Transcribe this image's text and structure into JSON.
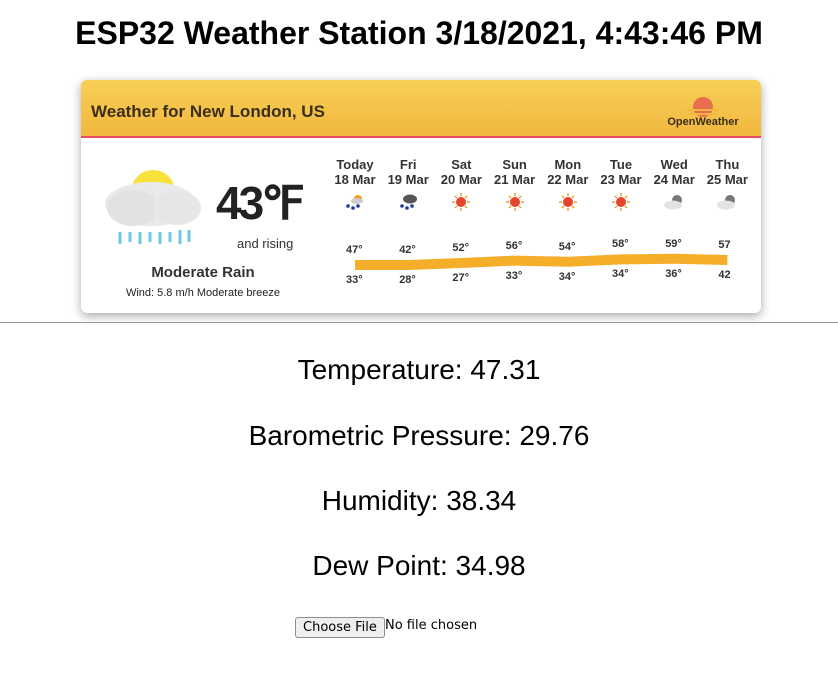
{
  "page": {
    "title": "ESP32 Weather Station 3/18/2021, 4:43:46 PM"
  },
  "widget": {
    "location": "Weather for New London, US",
    "brand": "OpenWeather",
    "current": {
      "temperature": "43℉",
      "trend": "and rising",
      "condition": "Moderate Rain",
      "wind": "Wind: 5.8 m/h Moderate breeze",
      "icon": "rain-cloud-sun-icon"
    },
    "forecast": [
      {
        "day": "Today",
        "date": "18 Mar",
        "icon": "snow-rain-icon",
        "high": "47°",
        "low": "33°"
      },
      {
        "day": "Fri",
        "date": "19 Mar",
        "icon": "snow-cloud-icon",
        "high": "42°",
        "low": "28°"
      },
      {
        "day": "Sat",
        "date": "20 Mar",
        "icon": "sun-icon",
        "high": "52°",
        "low": "27°"
      },
      {
        "day": "Sun",
        "date": "21 Mar",
        "icon": "sun-icon",
        "high": "56°",
        "low": "33°"
      },
      {
        "day": "Mon",
        "date": "22 Mar",
        "icon": "sun-icon",
        "high": "54°",
        "low": "34°"
      },
      {
        "day": "Tue",
        "date": "23 Mar",
        "icon": "sun-icon",
        "high": "58°",
        "low": "34°"
      },
      {
        "day": "Wed",
        "date": "24 Mar",
        "icon": "cloud-icon",
        "high": "59°",
        "low": "36°"
      },
      {
        "day": "Thu",
        "date": "25 Mar",
        "icon": "cloud-icon",
        "high": "57",
        "low": "42"
      }
    ],
    "band_color": "#f5ae2a",
    "header_color": "#f2b73f",
    "accent_line_color": "#e84a5f"
  },
  "readings": {
    "temperature": "Temperature: 47.31",
    "pressure": "Barometric Pressure: 29.76",
    "humidity": "Humidity: 38.34",
    "dew_point": "Dew Point: 34.98"
  },
  "file_input": {
    "button_label": "Choose File",
    "status": "No file chosen"
  }
}
